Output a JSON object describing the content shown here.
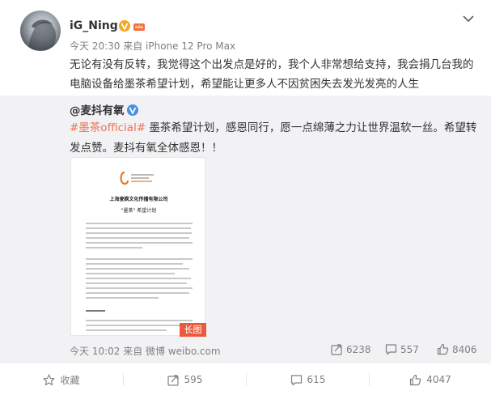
{
  "post": {
    "username": "iG_Ning",
    "meta": "今天 20:30 来自 iPhone 12 Pro Max",
    "text": "无论有没有反转，我觉得这个出发点是好的，我个人非常想给支持，我会捐几台我的电脑设备给墨茶希望计划，希望能让更多人不因贫困失去发光发亮的人生"
  },
  "repost": {
    "author": "@麦抖有氧",
    "tag": "#墨茶official#",
    "text": " 墨茶希望计划，感恩同行，愿一点绵薄之力让世界温软一丝。希望转发点赞。麦抖有氧全体感恩！！",
    "image_badge": "长图",
    "meta": "今天 10:02 来自 微博 weibo.com",
    "stats": {
      "forward": "6238",
      "comment": "557",
      "like": "8406"
    },
    "doc": {
      "company": "上海瓷枫文化传播有限公司",
      "subtitle": "\"墨茶\" 希望计划"
    }
  },
  "toolbar": {
    "collect": "收藏",
    "forward": "595",
    "comment": "615",
    "like": "4047"
  },
  "colors": {
    "accent": "#eb7350",
    "verified": "#f5a623",
    "long_badge": "#ec5a3c"
  }
}
